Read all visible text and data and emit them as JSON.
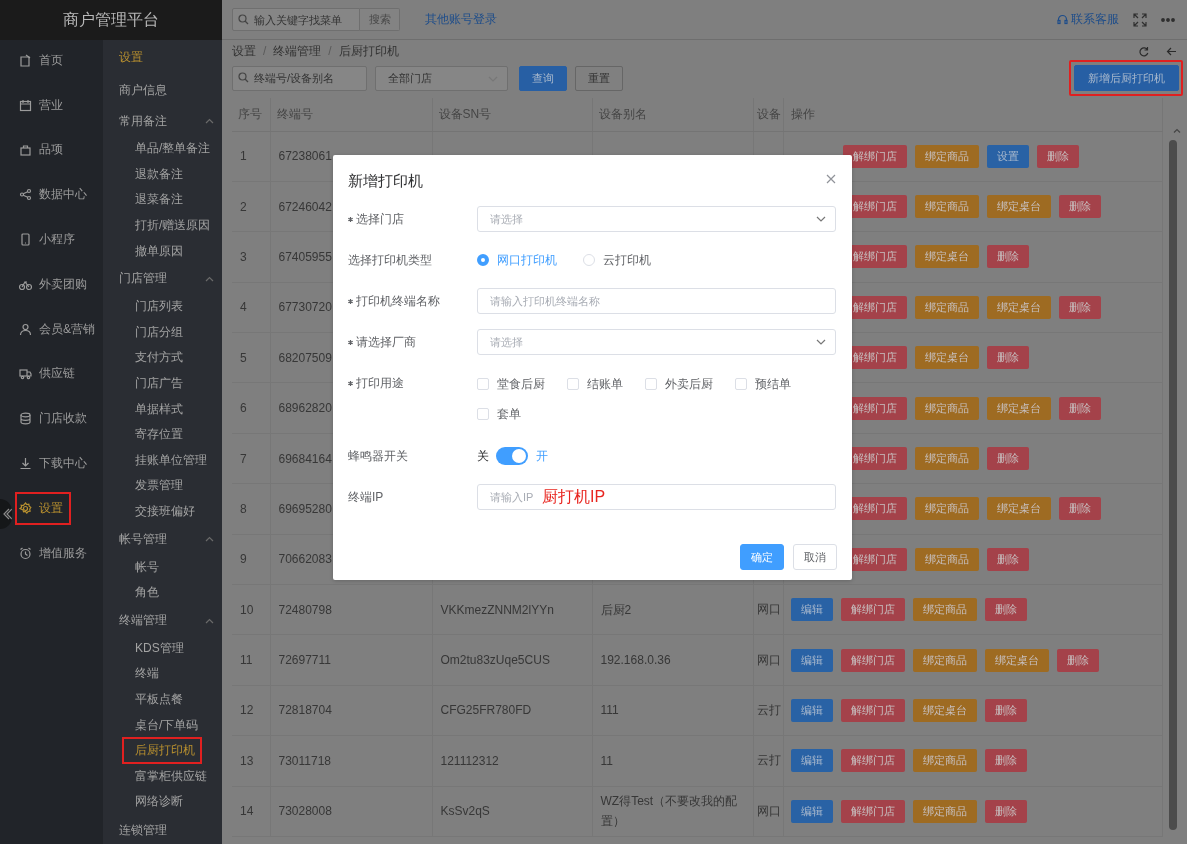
{
  "app_title": "商户管理平台",
  "nav": [
    {
      "label": "首页",
      "selected": false,
      "highlighted": false
    },
    {
      "label": "营业",
      "selected": false,
      "highlighted": false
    },
    {
      "label": "品项",
      "selected": false,
      "highlighted": false
    },
    {
      "label": "数据中心",
      "selected": false,
      "highlighted": false
    },
    {
      "label": "小程序",
      "selected": false,
      "highlighted": false
    },
    {
      "label": "外卖团购",
      "selected": false,
      "highlighted": false
    },
    {
      "label": "会员&营销",
      "selected": false,
      "highlighted": false
    },
    {
      "label": "供应链",
      "selected": false,
      "highlighted": false
    },
    {
      "label": "门店收款",
      "selected": false,
      "highlighted": false
    },
    {
      "label": "下载中心",
      "selected": false,
      "highlighted": false
    },
    {
      "label": "设置",
      "selected": true,
      "highlighted": true
    },
    {
      "label": "增值服务",
      "selected": false,
      "highlighted": false
    }
  ],
  "submenu": {
    "title": "设置",
    "items": [
      {
        "kind": "link",
        "label": "商户信息"
      },
      {
        "kind": "group",
        "label": "常用备注",
        "expanded": true,
        "children": [
          {
            "label": "单品/整单备注",
            "selected": false,
            "highlighted": false
          },
          {
            "label": "退款备注",
            "selected": false,
            "highlighted": false
          },
          {
            "label": "退菜备注",
            "selected": false,
            "highlighted": false
          },
          {
            "label": "打折/赠送原因",
            "selected": false,
            "highlighted": false
          },
          {
            "label": "撤单原因",
            "selected": false,
            "highlighted": false
          }
        ]
      },
      {
        "kind": "group",
        "label": "门店管理",
        "expanded": true,
        "children": [
          {
            "label": "门店列表",
            "selected": false,
            "highlighted": false
          },
          {
            "label": "门店分组",
            "selected": false,
            "highlighted": false
          },
          {
            "label": "支付方式",
            "selected": false,
            "highlighted": false
          },
          {
            "label": "门店广告",
            "selected": false,
            "highlighted": false
          },
          {
            "label": "单据样式",
            "selected": false,
            "highlighted": false
          },
          {
            "label": "寄存位置",
            "selected": false,
            "highlighted": false
          },
          {
            "label": "挂账单位管理",
            "selected": false,
            "highlighted": false
          },
          {
            "label": "发票管理",
            "selected": false,
            "highlighted": false
          },
          {
            "label": "交接班偏好",
            "selected": false,
            "highlighted": false
          }
        ]
      },
      {
        "kind": "group",
        "label": "帐号管理",
        "expanded": true,
        "children": [
          {
            "label": "帐号",
            "selected": false,
            "highlighted": false
          },
          {
            "label": "角色",
            "selected": false,
            "highlighted": false
          }
        ]
      },
      {
        "kind": "group",
        "label": "终端管理",
        "expanded": true,
        "children": [
          {
            "label": "KDS管理",
            "selected": false,
            "highlighted": false
          },
          {
            "label": "终端",
            "selected": false,
            "highlighted": false
          },
          {
            "label": "平板点餐",
            "selected": false,
            "highlighted": false
          },
          {
            "label": "桌台/下单码",
            "selected": false,
            "highlighted": false
          },
          {
            "label": "后厨打印机",
            "selected": true,
            "highlighted": true
          },
          {
            "label": "富掌柜供应链",
            "selected": false,
            "highlighted": false
          },
          {
            "label": "网络诊断",
            "selected": false,
            "highlighted": false
          }
        ]
      },
      {
        "kind": "link",
        "label": "连锁管理"
      }
    ]
  },
  "topbar": {
    "search_placeholder": "输入关键字找菜单",
    "search_button": "搜索",
    "link": "其他账号登录",
    "support": "联系客服"
  },
  "breadcrumb": {
    "separator": "/",
    "items": [
      "设置",
      "终端管理",
      "后厨打印机"
    ]
  },
  "filters": {
    "terminal_placeholder": "终端号/设备别名",
    "store_placeholder": "全部门店",
    "query": "查询",
    "reset": "重置",
    "add": "新增后厨打印机",
    "add_highlighted": true
  },
  "table": {
    "columns": [
      "序号",
      "终端号",
      "设备SN号",
      "设备别名",
      "设备",
      "操作"
    ],
    "rows": [
      {
        "index": "1",
        "terminal": "67238061",
        "covered": true,
        "actions": [
          {
            "label": "解绑门店",
            "kind": "danger"
          },
          {
            "label": "绑定商品",
            "kind": "warning"
          },
          {
            "label": "设置",
            "kind": "primary"
          },
          {
            "label": "删除",
            "kind": "danger"
          }
        ]
      },
      {
        "index": "2",
        "terminal": "67246042",
        "covered": true,
        "actions": [
          {
            "label": "解绑门店",
            "kind": "danger"
          },
          {
            "label": "绑定商品",
            "kind": "warning"
          },
          {
            "label": "绑定桌台",
            "kind": "warning"
          },
          {
            "label": "删除",
            "kind": "danger"
          }
        ]
      },
      {
        "index": "3",
        "terminal": "67405955",
        "covered": true,
        "actions": [
          {
            "label": "解绑门店",
            "kind": "danger"
          },
          {
            "label": "绑定桌台",
            "kind": "warning"
          },
          {
            "label": "删除",
            "kind": "danger"
          }
        ]
      },
      {
        "index": "4",
        "terminal": "67730720",
        "covered": true,
        "actions": [
          {
            "label": "解绑门店",
            "kind": "danger"
          },
          {
            "label": "绑定商品",
            "kind": "warning"
          },
          {
            "label": "绑定桌台",
            "kind": "warning"
          },
          {
            "label": "删除",
            "kind": "danger"
          }
        ]
      },
      {
        "index": "5",
        "terminal": "68207509",
        "covered": true,
        "actions": [
          {
            "label": "解绑门店",
            "kind": "danger"
          },
          {
            "label": "绑定桌台",
            "kind": "warning"
          },
          {
            "label": "删除",
            "kind": "danger"
          }
        ]
      },
      {
        "index": "6",
        "terminal": "68962820",
        "covered": true,
        "actions": [
          {
            "label": "解绑门店",
            "kind": "danger"
          },
          {
            "label": "绑定商品",
            "kind": "warning"
          },
          {
            "label": "绑定桌台",
            "kind": "warning"
          },
          {
            "label": "删除",
            "kind": "danger"
          }
        ]
      },
      {
        "index": "7",
        "terminal": "69684164",
        "covered": true,
        "actions": [
          {
            "label": "解绑门店",
            "kind": "danger"
          },
          {
            "label": "绑定商品",
            "kind": "warning"
          },
          {
            "label": "删除",
            "kind": "danger"
          }
        ]
      },
      {
        "index": "8",
        "terminal": "69695280",
        "covered": true,
        "actions": [
          {
            "label": "解绑门店",
            "kind": "danger"
          },
          {
            "label": "绑定商品",
            "kind": "warning"
          },
          {
            "label": "绑定桌台",
            "kind": "warning"
          },
          {
            "label": "删除",
            "kind": "danger"
          }
        ]
      },
      {
        "index": "9",
        "terminal": "70662083",
        "covered": true,
        "actions": [
          {
            "label": "解绑门店",
            "kind": "danger"
          },
          {
            "label": "绑定商品",
            "kind": "warning"
          },
          {
            "label": "删除",
            "kind": "danger"
          }
        ]
      },
      {
        "index": "10",
        "terminal": "72480798",
        "sn": "VKKmezZNNM2lYYn",
        "alias": "后厨2",
        "device": "网口",
        "covered": false,
        "actions": [
          {
            "label": "编辑",
            "kind": "primary"
          },
          {
            "label": "解绑门店",
            "kind": "danger"
          },
          {
            "label": "绑定商品",
            "kind": "warning"
          },
          {
            "label": "删除",
            "kind": "danger"
          }
        ]
      },
      {
        "index": "11",
        "terminal": "72697711",
        "sn": "Om2tu83zUqe5CUS",
        "alias": "192.168.0.36",
        "device": "网口",
        "covered": false,
        "actions": [
          {
            "label": "编辑",
            "kind": "primary"
          },
          {
            "label": "解绑门店",
            "kind": "danger"
          },
          {
            "label": "绑定商品",
            "kind": "warning"
          },
          {
            "label": "绑定桌台",
            "kind": "warning"
          },
          {
            "label": "删除",
            "kind": "danger"
          }
        ]
      },
      {
        "index": "12",
        "terminal": "72818704",
        "sn": "CFG25FR780FD",
        "alias": "111",
        "device": "云打",
        "covered": false,
        "actions": [
          {
            "label": "编辑",
            "kind": "primary"
          },
          {
            "label": "解绑门店",
            "kind": "danger"
          },
          {
            "label": "绑定桌台",
            "kind": "warning"
          },
          {
            "label": "删除",
            "kind": "danger"
          }
        ]
      },
      {
        "index": "13",
        "terminal": "73011718",
        "sn": "121112312",
        "alias": "11",
        "device": "云打",
        "covered": false,
        "actions": [
          {
            "label": "编辑",
            "kind": "primary"
          },
          {
            "label": "解绑门店",
            "kind": "danger"
          },
          {
            "label": "绑定商品",
            "kind": "warning"
          },
          {
            "label": "删除",
            "kind": "danger"
          }
        ]
      },
      {
        "index": "14",
        "terminal": "73028008",
        "sn": "KsSv2qS",
        "alias": "WZ得Test（不要改我的配置）",
        "device": "网口",
        "covered": false,
        "actions": [
          {
            "label": "编辑",
            "kind": "primary"
          },
          {
            "label": "解绑门店",
            "kind": "danger"
          },
          {
            "label": "绑定商品",
            "kind": "warning"
          },
          {
            "label": "删除",
            "kind": "danger"
          }
        ]
      }
    ]
  },
  "dialog": {
    "title": "新增打印机",
    "fields": [
      {
        "kind": "select",
        "label": "选择门店",
        "required": true,
        "placeholder": "请选择"
      },
      {
        "kind": "radio",
        "label": "选择打印机类型",
        "required": false,
        "options": [
          {
            "label": "网口打印机",
            "selected": true
          },
          {
            "label": "云打印机",
            "selected": false
          }
        ]
      },
      {
        "kind": "input",
        "label": "打印机终端名称",
        "required": true,
        "placeholder": "请输入打印机终端名称"
      },
      {
        "kind": "select",
        "label": "请选择厂商",
        "required": true,
        "placeholder": "请选择"
      },
      {
        "kind": "checkboxes",
        "label": "打印用途",
        "required": true,
        "options": [
          {
            "label": "堂食后厨",
            "checked": false
          },
          {
            "label": "结账单",
            "checked": false
          },
          {
            "label": "外卖后厨",
            "checked": false
          },
          {
            "label": "预结单",
            "checked": false
          },
          {
            "label": "套单",
            "checked": false
          }
        ]
      },
      {
        "kind": "switch",
        "label": "蜂鸣器开关",
        "required": false,
        "off_label": "关",
        "on_label": "开",
        "on": true
      },
      {
        "kind": "input",
        "label": "终端IP",
        "required": false,
        "placeholder": "请输入IP",
        "annotation": "厨打机IP"
      }
    ],
    "buttons": [
      {
        "label": "确定",
        "kind": "primary"
      },
      {
        "label": "取消",
        "kind": "default"
      }
    ]
  }
}
